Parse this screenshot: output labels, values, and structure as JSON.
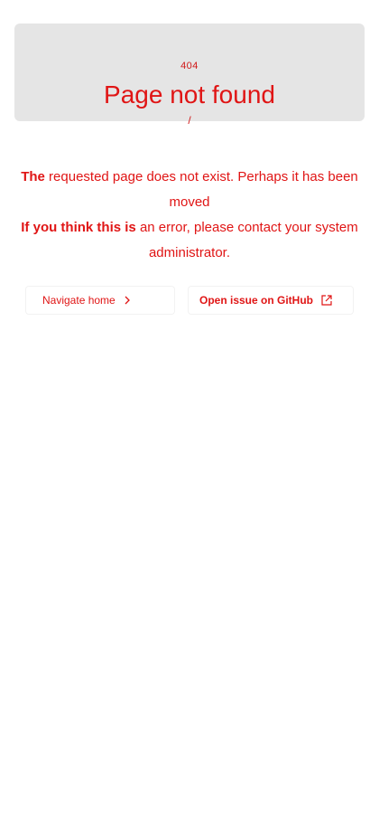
{
  "banner": {
    "code": "404",
    "title": "Page not found",
    "mark": "/"
  },
  "message": {
    "line1_bold": "The",
    "line1_rest": " requested page does not exist. Perhaps it has been moved",
    "line2_bold": "If you think this is",
    "line2_rest": " an error, please contact your system administrator."
  },
  "actions": {
    "home_label": "Navigate home",
    "issue_label": "Open issue on GitHub"
  },
  "icons": {
    "home": "chevron-right-icon",
    "issue": "external-link-icon"
  },
  "colors": {
    "accent": "#e01515",
    "banner_bg": "#e5e5e5"
  }
}
